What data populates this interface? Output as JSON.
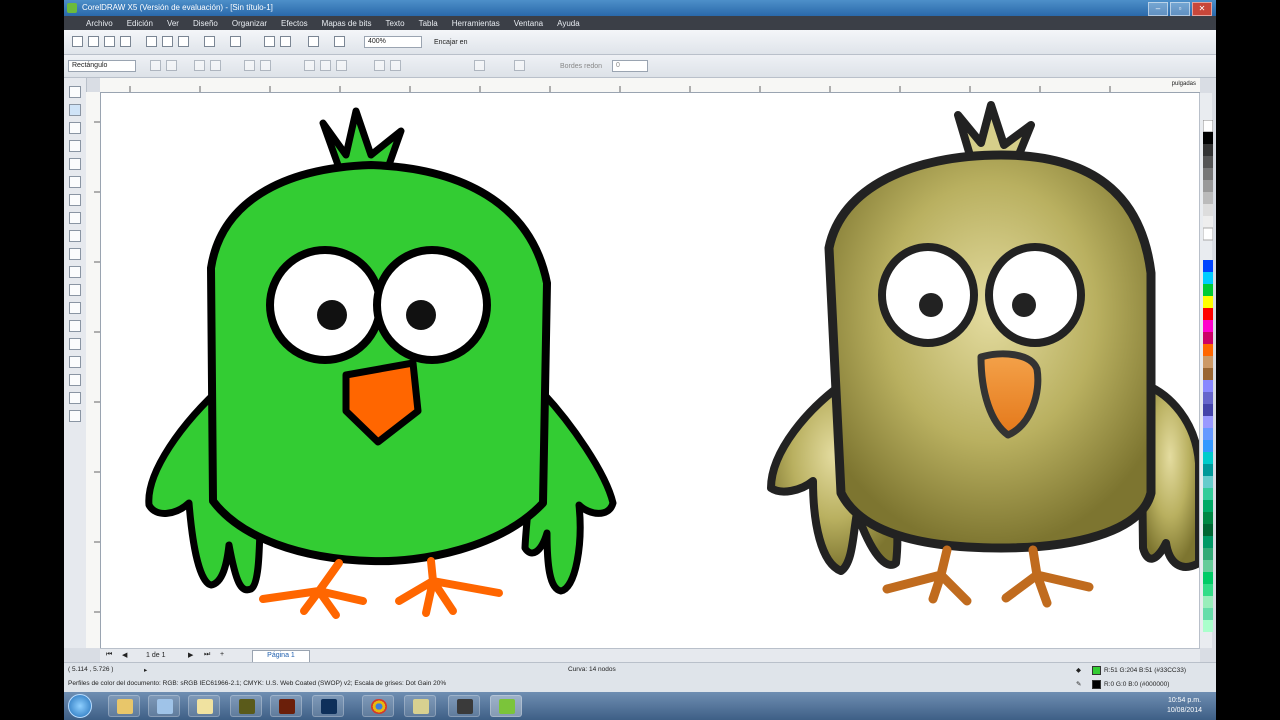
{
  "window": {
    "title": "CorelDRAW X5 (Versión de evaluación) - [Sin título-1]"
  },
  "menubar": [
    "Archivo",
    "Edición",
    "Ver",
    "Diseño",
    "Organizar",
    "Efectos",
    "Mapas de bits",
    "Texto",
    "Tabla",
    "Herramientas",
    "Ventana",
    "Ayuda"
  ],
  "toolbar": {
    "zoom_value": "400%",
    "snap_label": "Encajar en",
    "object_type": "Rectángulo",
    "outline_label": "Bordes redon",
    "outline_value": "0"
  },
  "ruler": {
    "unit": "pulgadas"
  },
  "pages": {
    "counter": "1 de 1",
    "tab": "Página 1"
  },
  "status": {
    "coords": "( 5.114 , 5.726 )",
    "curve_info": "Curva: 14 nodos",
    "color_profile": "Perfiles de color del documento: RGB: sRGB IEC61966-2.1; CMYK: U.S. Web Coated (SWOP) v2; Escala de grises: Dot Gain 20%",
    "fill_info": "R:51 G:204 B:51 (#33CC33)",
    "outline_info": "R:0 G:0 B:0 (#000000)"
  },
  "colors": {
    "bird_green": "#33CC33",
    "beak_orange": "#FF6600",
    "bird_olive": "#A09A48",
    "outline": "#000000"
  },
  "clock": {
    "time": "10:54 p.m.",
    "date": "10/08/2014"
  },
  "icons": [
    "start-orb-icon",
    "explorer-icon",
    "folder-icon",
    "muse-icon",
    "illustrator-icon",
    "photoshop-icon",
    "chrome-icon",
    "files-icon",
    "stamp-icon",
    "coreldraw-icon"
  ]
}
